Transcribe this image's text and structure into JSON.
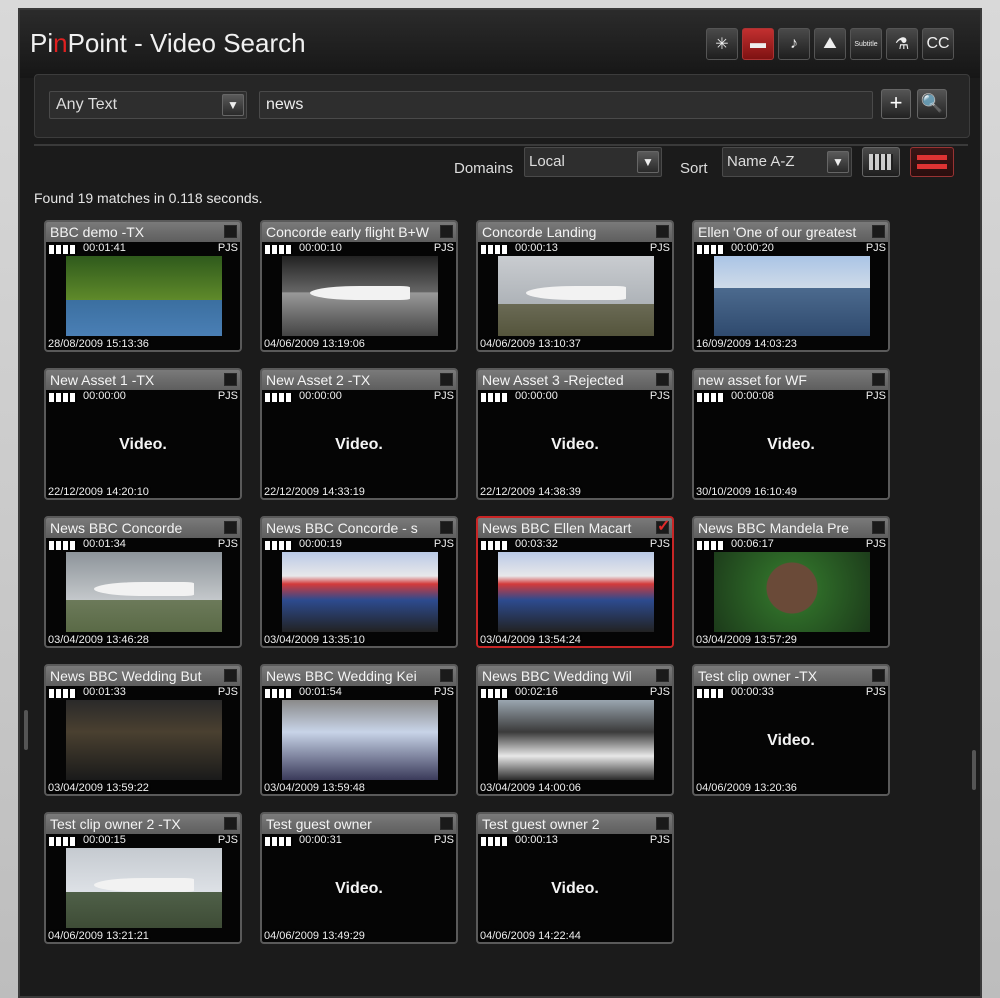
{
  "app": {
    "title_prefix": "Pi",
    "title_accent": "n",
    "title_rest": "Point - Video Search"
  },
  "toolbar": [
    {
      "name": "image-filter-button",
      "glyph": "✳",
      "active": false
    },
    {
      "name": "video-filter-button",
      "glyph": "▬",
      "active": true
    },
    {
      "name": "audio-filter-button",
      "glyph": "♪",
      "active": false
    },
    {
      "name": "chart-filter-button",
      "glyph": "⛰",
      "active": false
    },
    {
      "name": "subtitle-filter-button",
      "glyph": "Subtitle",
      "active": false
    },
    {
      "name": "link-filter-button",
      "glyph": "⚗",
      "active": false
    },
    {
      "name": "cc-filter-button",
      "glyph": "CC",
      "active": false
    }
  ],
  "search": {
    "field_type": "Any Text",
    "query": "news",
    "add_label": "+",
    "go_label": "🔍"
  },
  "filters": {
    "domains_label": "Domains",
    "domains_value": "Local",
    "sort_label": "Sort",
    "sort_value": "Name A-Z"
  },
  "results_summary": "Found 19 matches in 0.118 seconds.",
  "video_placeholder": "Video.",
  "cards": [
    {
      "title": "BBC demo -TX",
      "duration": "00:01:41",
      "owner": "PJS",
      "date": "28/08/2009 15:13:36",
      "scene": "trees",
      "checked": false
    },
    {
      "title": "Concorde early flight B+W",
      "duration": "00:00:10",
      "owner": "PJS",
      "date": "04/06/2009 13:19:06",
      "scene": "bw",
      "checked": false
    },
    {
      "title": "Concorde Landing",
      "duration": "00:00:13",
      "owner": "PJS",
      "date": "04/06/2009 13:10:37",
      "scene": "runway",
      "checked": false
    },
    {
      "title": "Ellen 'One of our greatest",
      "duration": "00:00:20",
      "owner": "PJS",
      "date": "16/09/2009 14:03:23",
      "scene": "marina",
      "checked": false
    },
    {
      "title": "New Asset 1 -TX",
      "duration": "00:00:00",
      "owner": "PJS",
      "date": "22/12/2009 14:20:10",
      "scene": "video",
      "checked": false
    },
    {
      "title": "New Asset 2 -TX",
      "duration": "00:00:00",
      "owner": "PJS",
      "date": "22/12/2009 14:33:19",
      "scene": "video",
      "checked": false
    },
    {
      "title": "New Asset 3 -Rejected",
      "duration": "00:00:00",
      "owner": "PJS",
      "date": "22/12/2009 14:38:39",
      "scene": "video",
      "checked": false
    },
    {
      "title": "new asset for WF",
      "duration": "00:00:08",
      "owner": "PJS",
      "date": "30/10/2009 16:10:49",
      "scene": "video",
      "checked": false
    },
    {
      "title": "News BBC Concorde",
      "duration": "00:01:34",
      "owner": "PJS",
      "date": "03/04/2009 13:46:28",
      "scene": "sky",
      "checked": false
    },
    {
      "title": "News BBC Concorde - s",
      "duration": "00:00:19",
      "owner": "PJS",
      "date": "03/04/2009 13:35:10",
      "scene": "crowd",
      "checked": false
    },
    {
      "title": "News BBC Ellen Macart",
      "duration": "00:03:32",
      "owner": "PJS",
      "date": "03/04/2009 13:54:24",
      "scene": "crowd",
      "checked": true
    },
    {
      "title": "News BBC Mandela Pre",
      "duration": "00:06:17",
      "owner": "PJS",
      "date": "03/04/2009 13:57:29",
      "scene": "mandela",
      "checked": false
    },
    {
      "title": "News BBC Wedding But",
      "duration": "00:01:33",
      "owner": "PJS",
      "date": "03/04/2009 13:59:22",
      "scene": "car",
      "checked": false
    },
    {
      "title": "News BBC Wedding Kei",
      "duration": "00:01:54",
      "owner": "PJS",
      "date": "03/04/2009 13:59:48",
      "scene": "sign",
      "checked": false
    },
    {
      "title": "News BBC Wedding Wil",
      "duration": "00:02:16",
      "owner": "PJS",
      "date": "03/04/2009 14:00:06",
      "scene": "wed",
      "checked": false
    },
    {
      "title": "Test clip owner -TX",
      "duration": "00:00:33",
      "owner": "PJS",
      "date": "04/06/2009 13:20:36",
      "scene": "video",
      "checked": false
    },
    {
      "title": "Test clip owner 2 -TX",
      "duration": "00:00:15",
      "owner": "PJS",
      "date": "04/06/2009 13:21:21",
      "scene": "jet",
      "checked": false
    },
    {
      "title": "Test guest owner",
      "duration": "00:00:31",
      "owner": "PJS",
      "date": "04/06/2009 13:49:29",
      "scene": "video",
      "checked": false
    },
    {
      "title": "Test guest owner 2",
      "duration": "00:00:13",
      "owner": "PJS",
      "date": "04/06/2009 14:22:44",
      "scene": "video",
      "checked": false
    }
  ]
}
